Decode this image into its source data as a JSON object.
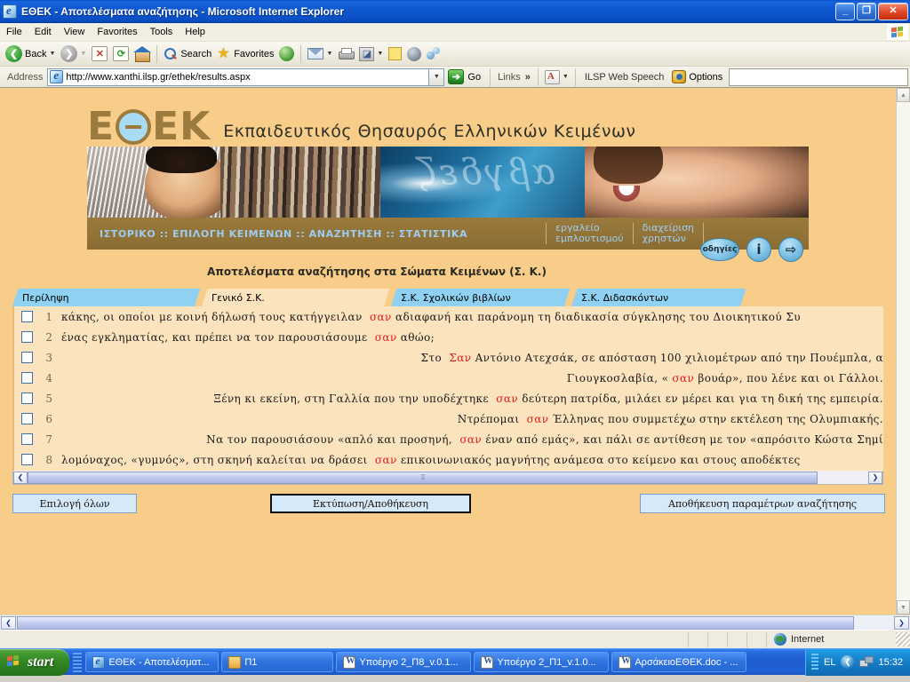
{
  "window": {
    "title": "ΕΘΕΚ - Αποτελέσματα αναζήτησης - Microsoft Internet Explorer",
    "minimize_label": "_",
    "maximize_label": "❐",
    "close_label": "✕"
  },
  "menu": {
    "items": [
      "File",
      "Edit",
      "View",
      "Favorites",
      "Tools",
      "Help"
    ]
  },
  "toolbar": {
    "back_label": "Back",
    "search_label": "Search",
    "favorites_label": "Favorites"
  },
  "address": {
    "label": "Address",
    "url": "http://www.xanthi.ilsp.gr/ethek/results.aspx",
    "go_label": "Go",
    "go_glyph": "➔",
    "links_label": "Links",
    "chevron": "»",
    "ilsp_label": "ILSP Web Speech",
    "options_label": "Options"
  },
  "site": {
    "logo_e1": "Ε",
    "logo_e2": "Ε",
    "logo_k": "Κ",
    "logo_subtitle": "Εκπαιδευτικός Θησαυρός Ελληνικών Κειμένων",
    "banner_letters": "αβγδεζ",
    "nav_main": "ΙΣΤΟΡΙΚΟ :: ΕΠΙΛΟΓΗ ΚΕΙΜΕΝΩΝ :: ΑΝΑΖΗΤΗΣΗ :: ΣΤΑΤΙΣΤΙΚΑ",
    "tool_enrichment_line1": "εργαλείο",
    "tool_enrichment_line2": "εμπλουτισμού",
    "tool_users_line1": "διαχείριση",
    "tool_users_line2": "χρηστών",
    "btn_help_label": "οδηγίες",
    "btn_info_label": "i",
    "btn_exit_label": "⇨"
  },
  "results": {
    "title": "Αποτελέσματα αναζήτησης στα Σώματα Κειμένων (Σ. Κ.)",
    "tabs": [
      {
        "label": "Περίληψη",
        "active": false
      },
      {
        "label": "Γενικό Σ.Κ.",
        "active": true
      },
      {
        "label": "Σ.Κ. Σχολικών βιβλίων",
        "active": false
      },
      {
        "label": "Σ.Κ. Διδασκόντων",
        "active": false
      }
    ],
    "keyword": "σαν",
    "rows": [
      {
        "num": "1",
        "align": "left",
        "before": "κάκης, οι οποίοι με κοινή δήλωσή τους κατήγγειλαν ",
        "kw": "σαν",
        "after": " αδιαφανή και παράνομη τη διαδικασία σύγκλησης του Διοικητικού Συ"
      },
      {
        "num": "2",
        "align": "left",
        "before": "ένας εγκληματίας, και πρέπει να τον παρουσιάσουμε ",
        "kw": "σαν",
        "after": " αθώο;"
      },
      {
        "num": "3",
        "align": "right",
        "before": "Στο ",
        "kw": "Σαν",
        "after": " Αντόνιο Ατεχσάκ, σε απόσταση 100 χιλιομέτρων από την Πουέμπλα, α"
      },
      {
        "num": "4",
        "align": "right",
        "before": "Γιουγκοσλαβία, «",
        "kw": "σαν",
        "after": " βουάρ», που λένε και οι Γάλλοι."
      },
      {
        "num": "5",
        "align": "right",
        "before": "Ξένη κι εκείνη, στη Γαλλία που την υποδέχτηκε ",
        "kw": "σαν",
        "after": " δεύτερη πατρίδα, μιλάει εν μέρει και για τη δική της εμπειρία."
      },
      {
        "num": "6",
        "align": "right",
        "before": "Ντρέπομαι ",
        "kw": "σαν",
        "after": " Έλληνας που συμμετέχω στην εκτέλεση της Ολυμπιακής."
      },
      {
        "num": "7",
        "align": "right",
        "before": "Να τον παρουσιάσουν «απλό και προσηνή, ",
        "kw": "σαν",
        "after": " έναν από εμάς», και πάλι σε αντίθεση με τον «απρόσιτο Κώστα Σημί"
      },
      {
        "num": "8",
        "align": "left",
        "before": "λομόναχος, «γυμνός», στη σκηνή καλείται να δράσει ",
        "kw": "σαν",
        "after": " επικοινωνιακός μαγνήτης ανάμεσα στο κείμενο και στους αποδέκτες"
      }
    ],
    "buttons": {
      "select_all": "Επιλογή όλων",
      "print_save": "Εκτύπωση/Αποθήκευση",
      "save_params": "Αποθήκευση παραμέτρων αναζήτησης"
    },
    "scroll_left_glyph": "❮",
    "scroll_right_glyph": "❯",
    "scroll_grip": "⁞⁞⁞"
  },
  "statusbar": {
    "zone_label": "Internet"
  },
  "taskbar": {
    "start_label": "start",
    "items": [
      {
        "label": "ΕΘΕΚ - Αποτελέσματ...",
        "icon": "ie-icon"
      },
      {
        "label": "Π1",
        "icon": "folder-icon"
      },
      {
        "label": "Υποέργο 2_Π8_v.0.1...",
        "icon": "word-icon"
      },
      {
        "label": "Υποέργο 2_Π1_v.1.0...",
        "icon": "word-icon"
      },
      {
        "label": "ΑρσάκειοΕΘΕΚ.doc - ...",
        "icon": "word-icon"
      }
    ],
    "language": "EL",
    "clock": "15:32"
  }
}
